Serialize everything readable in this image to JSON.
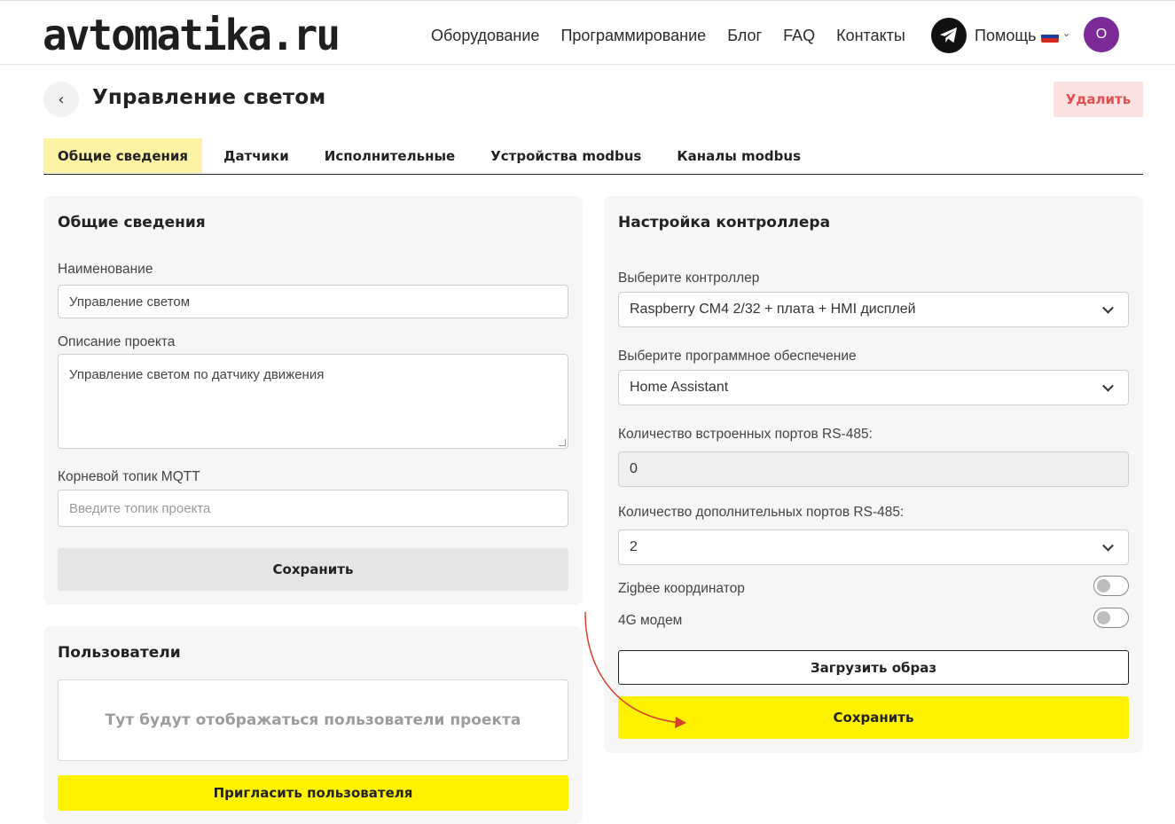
{
  "header": {
    "logo": "avtomatika.ru",
    "nav": [
      "Оборудование",
      "Программирование",
      "Блог",
      "FAQ",
      "Контакты"
    ],
    "help": "Помощь",
    "avatar_initial": "O",
    "icons": {
      "telegram": "telegram-icon",
      "flag": "russia-flag-icon",
      "chevron": "chevron-down-icon"
    }
  },
  "page": {
    "title": "Управление светом",
    "delete_label": "Удалить"
  },
  "tabs": [
    {
      "label": "Общие сведения",
      "active": true
    },
    {
      "label": "Датчики",
      "active": false
    },
    {
      "label": "Исполнительные",
      "active": false
    },
    {
      "label": "Устройства modbus",
      "active": false
    },
    {
      "label": "Каналы modbus",
      "active": false
    }
  ],
  "general": {
    "title": "Общие сведения",
    "name_label": "Наименование",
    "name_value": "Управление светом",
    "desc_label": "Описание проекта",
    "desc_value": "Управление светом по датчику движения",
    "topic_label": "Корневой топик MQTT",
    "topic_placeholder": "Введите топик проекта",
    "save_label": "Сохранить"
  },
  "users": {
    "title": "Пользователи",
    "empty_text": "Тут будут отображаться пользователи проекта",
    "invite_label": "Пригласить пользователя"
  },
  "controller": {
    "title": "Настройка контроллера",
    "controller_label": "Выберите контроллер",
    "controller_value": "Raspberry CM4 2/32 + плата + HMI дисплей",
    "software_label": "Выберите программное обеспечение",
    "software_value": "Home Assistant",
    "builtin_ports_label": "Количество встроенных портов RS-485:",
    "builtin_ports_value": "0",
    "extra_ports_label": "Количество дополнительных портов RS-485:",
    "extra_ports_value": "2",
    "zigbee_label": "Zigbee координатор",
    "zigbee_enabled": false,
    "modem_label": "4G модем",
    "modem_enabled": false,
    "upload_label": "Загрузить образ",
    "save_label": "Сохранить"
  },
  "colors": {
    "accent_yellow": "#fff200",
    "tab_active": "#fdf3a3",
    "delete_bg": "#fbe1e1",
    "delete_text": "#e05050",
    "avatar": "#7b2a98",
    "annotation_arrow": "#d9402b"
  }
}
